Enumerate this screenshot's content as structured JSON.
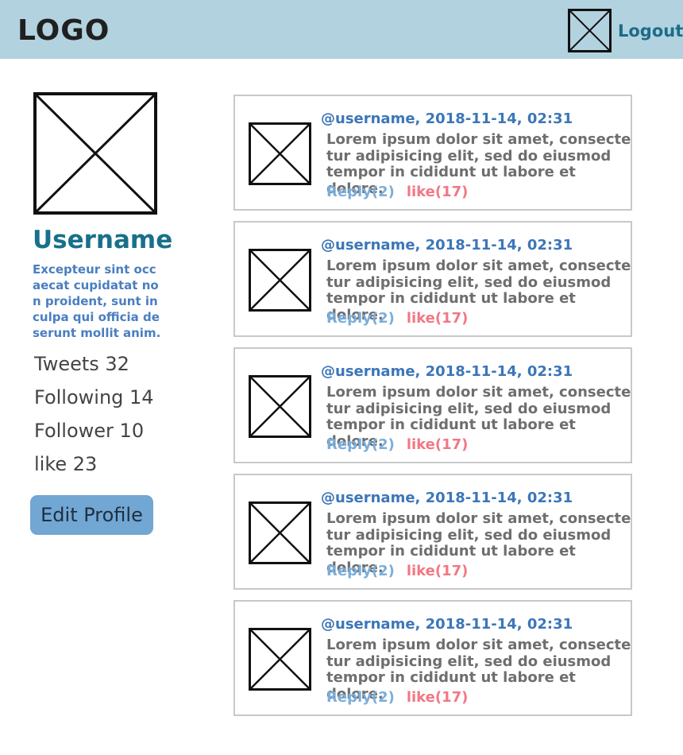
{
  "header": {
    "logo": "LOGO",
    "avatar_icon": "image-placeholder-icon",
    "logout_label": "Logout",
    "background": "#b2d2df"
  },
  "profile": {
    "picture_icon": "image-placeholder-icon",
    "username": "Username",
    "bio": "Excepteur sint occaecat cupidatat non proident, sunt in culpa qui officia deserunt mollit anim.",
    "stats": {
      "tweets": "Tweets 32",
      "following": "Following 14",
      "follower": "Follower 10",
      "like": "like 23"
    },
    "edit_label": "Edit Profile"
  },
  "tweets": [
    {
      "meta": "@username, 2018-11-14, 02:31",
      "body": "Lorem ipsum dolor sit amet, consecte tur adipisicing elit, sed do eiusmod tempor in cididunt ut labore et dolore.",
      "reply": "Reply(2)",
      "like": "like(17)"
    },
    {
      "meta": "@username, 2018-11-14, 02:31",
      "body": "Lorem ipsum dolor sit amet, consecte tur adipisicing elit, sed do eiusmod tempor in cididunt ut labore et dolore.",
      "reply": "Reply(2)",
      "like": "like(17)"
    },
    {
      "meta": "@username, 2018-11-14, 02:31",
      "body": "Lorem ipsum dolor sit amet, consecte tur adipisicing elit, sed do eiusmod tempor in cididunt ut labore et dolore.",
      "reply": "Reply(2)",
      "like": "like(17)"
    },
    {
      "meta": "@username, 2018-11-14, 02:31",
      "body": "Lorem ipsum dolor sit amet, consecte tur adipisicing elit, sed do eiusmod tempor in cididunt ut labore et dolore.",
      "reply": "Reply(2)",
      "like": "like(17)"
    },
    {
      "meta": "@username, 2018-11-14, 02:31",
      "body": "Lorem ipsum dolor sit amet, consecte tur adipisicing elit, sed do eiusmod tempor in cididunt ut labore et dolore.",
      "reply": "Reply(2)",
      "like": "like(17)"
    }
  ],
  "colors": {
    "accent": "#18708a",
    "bio": "#4a7ec0",
    "button": "#72a6d3",
    "reply": "#7aaedb",
    "like": "#f17884"
  }
}
